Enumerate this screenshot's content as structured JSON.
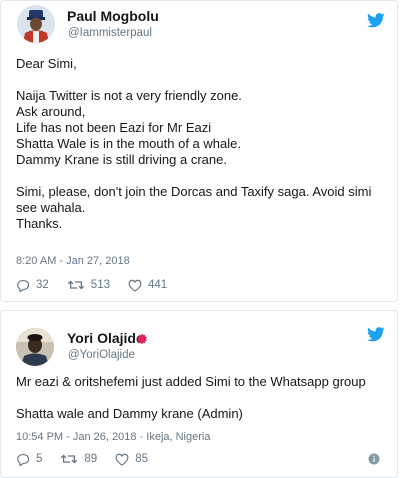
{
  "tweets": [
    {
      "author": {
        "name": "Paul Mogbolu",
        "handle": "@Iammisterpaul"
      },
      "paragraphs": [
        [
          "Dear Simi,"
        ],
        [
          "Naija Twitter is not a very friendly zone.",
          "Ask around,",
          "Life has not been Eazi for Mr Eazi",
          "Shatta Wale is in the mouth of a whale.",
          "Dammy Krane is still driving a crane."
        ],
        [
          "Simi, please, don't join the Dorcas and Taxify saga. Avoid simi",
          "see wahala.",
          "Thanks."
        ]
      ],
      "timestamp": "8:20 AM - Jan 27, 2018",
      "replies": "32",
      "retweets": "513",
      "likes": "441"
    },
    {
      "author": {
        "name": "Yori Olajide",
        "handle": "@YoriOlajide"
      },
      "paragraphs": [
        [
          "Mr eazi & oritshefemi just added Simi to the Whatsapp group"
        ],
        [
          "Shatta wale and Dammy krane (Admin)"
        ]
      ],
      "timestamp": "10:54 PM - Jan 26, 2018",
      "location": "Ikeja, Nigeria",
      "replies": "5",
      "retweets": "89",
      "likes": "85"
    }
  ],
  "colors": {
    "twitter_blue": "#1da1f2",
    "muted_text": "#657786",
    "border": "#e1e8ed",
    "emoji_red": "#e0245e"
  },
  "icons": [
    "twitter-bird-icon",
    "reply-icon",
    "retweet-icon",
    "like-heart-icon",
    "info-icon",
    "verified-badge-icon"
  ]
}
